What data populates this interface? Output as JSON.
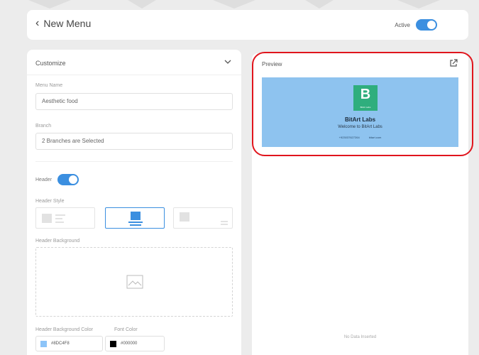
{
  "header": {
    "back_icon": "chevron-left-icon",
    "title": "New Menu",
    "active_label": "Active",
    "active_on": true
  },
  "customize": {
    "title": "Customize",
    "collapse_icon": "chevron-down-icon",
    "menu_name_label": "Menu Name",
    "menu_name_value": "Aesthetic food",
    "branch_label": "Branch",
    "branch_value": "2 Branches are Selected",
    "header_label": "Header",
    "header_on": true,
    "header_style_label": "Header Style",
    "header_style_options": [
      "left",
      "center",
      "right"
    ],
    "header_style_selected": "center",
    "header_background_label": "Header Background",
    "upload_icon": "image-icon",
    "bg_color_label": "Header Background Color",
    "bg_color_value": "#8DC4F8",
    "font_color_label": "Font Color",
    "font_color_value": "#000000"
  },
  "preview": {
    "title": "Preview",
    "open_icon": "external-link-icon",
    "logo_letter": "B",
    "logo_caption": "BitArt Labs",
    "brand_name": "BitArt Labs",
    "welcome": "Welcome to BitArt Labs",
    "phone": "+923037627264",
    "website": "bitart.com",
    "banner_color": "#8ec3ef",
    "no_data": "No Data Inserted"
  },
  "colors": {
    "accent": "#3b8fe0",
    "highlight": "#e0151d",
    "logo_bg": "#2fae7d"
  }
}
